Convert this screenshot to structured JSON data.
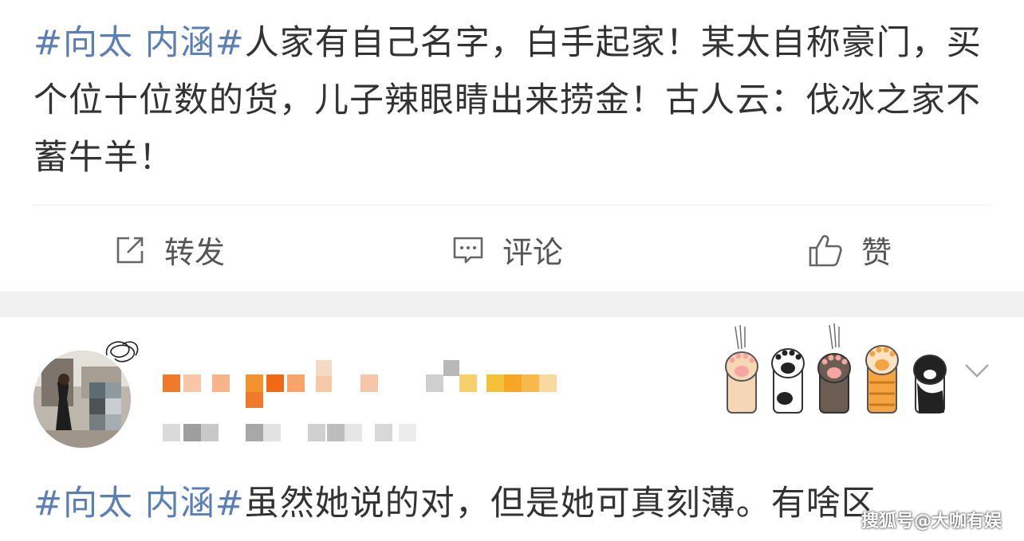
{
  "post1": {
    "hashtag": "#向太 内涵#",
    "body": "人家有自己名字，白手起家！某太自称豪门，买个位十位数的货，儿子辣眼睛出来捞金！古人云：伐冰之家不蓄牛羊！"
  },
  "actions": {
    "repost_label": "转发",
    "comment_label": "评论",
    "like_label": "赞"
  },
  "post2": {
    "hashtag": "#向太 内涵#",
    "body": "虽然她说的对，但是她可真刻薄。有啥区"
  },
  "watermark": "搜狐号@大咖有娱",
  "colors": {
    "hashtag": "#5b7fb5",
    "text": "#333333",
    "section_gap": "#f0f0f0",
    "icon": "#666666"
  },
  "icons": [
    "repost-icon",
    "comment-icon",
    "like-icon",
    "chevron-down-icon",
    "cat-paw-sticker"
  ]
}
